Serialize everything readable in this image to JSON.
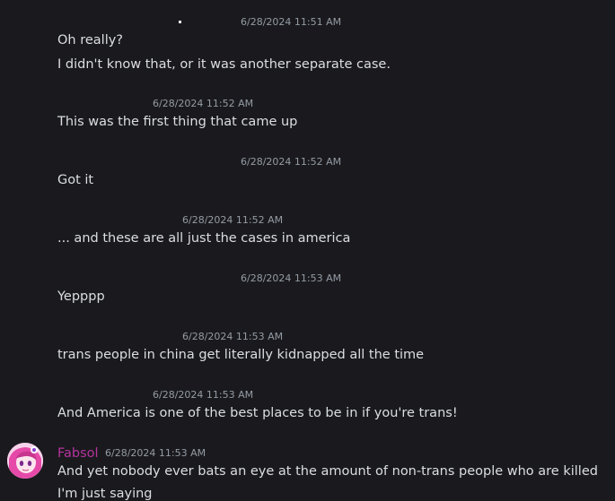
{
  "messages": [
    {
      "timestamp": "6/28/2024 11:51 AM",
      "lines": [
        "Oh really?",
        "I didn't know that, or it was another separate case."
      ]
    },
    {
      "timestamp": "6/28/2024 11:52 AM",
      "lines": [
        "This was the first thing that came up"
      ]
    },
    {
      "timestamp": "6/28/2024 11:52 AM",
      "lines": [
        "Got it"
      ]
    },
    {
      "timestamp": "6/28/2024 11:52 AM",
      "lines": [
        "... and these are all just the cases in america"
      ]
    },
    {
      "timestamp": "6/28/2024 11:53 AM",
      "lines": [
        "Yepppp"
      ]
    },
    {
      "timestamp": "6/28/2024 11:53 AM",
      "lines": [
        "trans people in china get literally kidnapped all the time"
      ]
    },
    {
      "timestamp": "6/28/2024 11:53 AM",
      "lines": [
        "And America is one of the best places to be in if you're trans!"
      ]
    },
    {
      "author": "Fabsol",
      "author_color": "#b5339d",
      "timestamp": "6/28/2024 11:53 AM",
      "lines": [
        "And yet nobody ever bats an eye at the amount of non-trans people who are killed",
        "I'm just saying"
      ]
    }
  ]
}
